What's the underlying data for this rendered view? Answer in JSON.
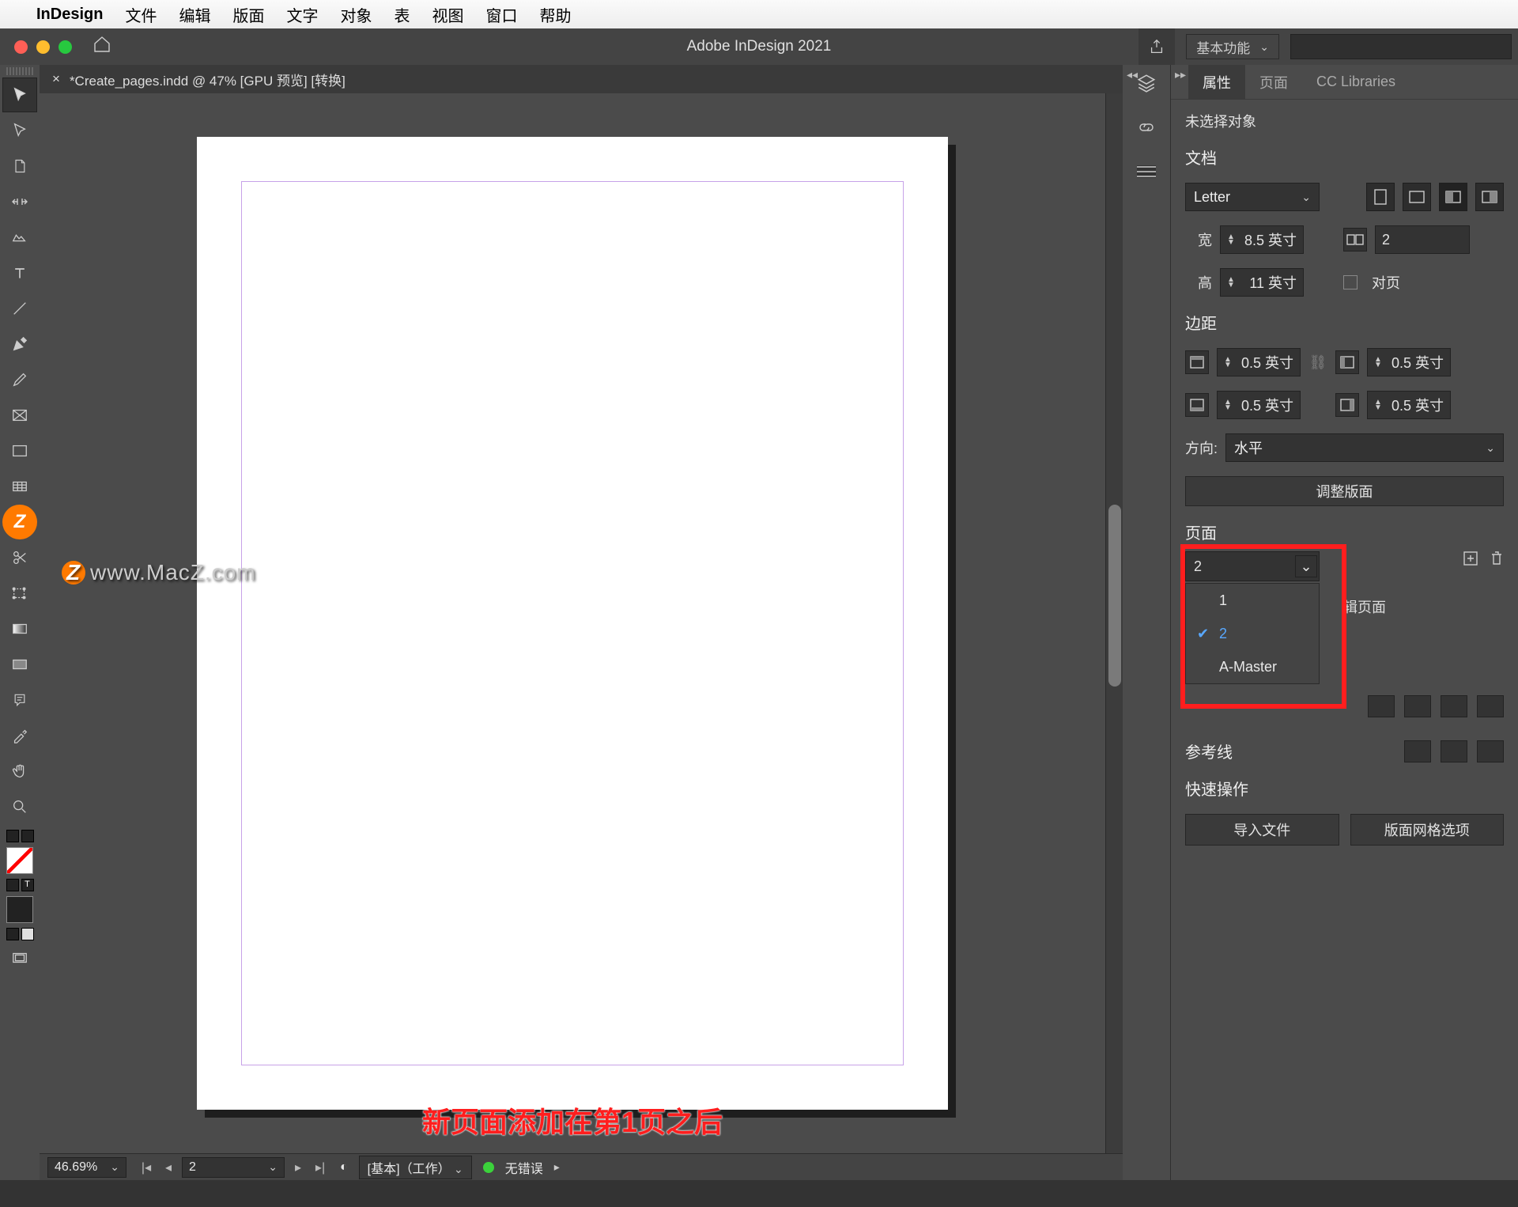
{
  "menubar": {
    "app": "InDesign",
    "items": [
      "文件",
      "编辑",
      "版面",
      "文字",
      "对象",
      "表",
      "视图",
      "窗口",
      "帮助"
    ]
  },
  "appbar": {
    "title": "Adobe InDesign 2021",
    "workspace": "基本功能"
  },
  "tab": {
    "label": "*Create_pages.indd @ 47% [GPU 预览] [转换]"
  },
  "watermark": "www.MacZ.com",
  "annotation": "新页面添加在第1页之后",
  "statusbar": {
    "zoom": "46.69%",
    "page": "2",
    "profile": "[基本]（工作）",
    "errors": "无错误"
  },
  "panel": {
    "tabs": [
      "属性",
      "页面",
      "CC Libraries"
    ],
    "no_selection": "未选择对象",
    "doc_section": "文档",
    "preset": "Letter",
    "w_label": "宽",
    "w_value": "8.5 英寸",
    "h_label": "高",
    "h_value": "11 英寸",
    "binding_value": "2",
    "facing_label": "对页",
    "margins_label": "边距",
    "m_top": "0.5 英寸",
    "m_bottom": "0.5 英寸",
    "m_left": "0.5 英寸",
    "m_right": "0.5 英寸",
    "orient_label": "方向:",
    "orient_value": "水平",
    "adjust_layout": "调整版面",
    "pages_label": "页面",
    "page_selector": "2",
    "page_options": [
      "1",
      "2",
      "A-Master"
    ],
    "edit_page": "辑页面",
    "guides_label": "参考线",
    "quick_label": "快速操作",
    "import_file": "导入文件",
    "layout_grid": "版面网格选项"
  }
}
